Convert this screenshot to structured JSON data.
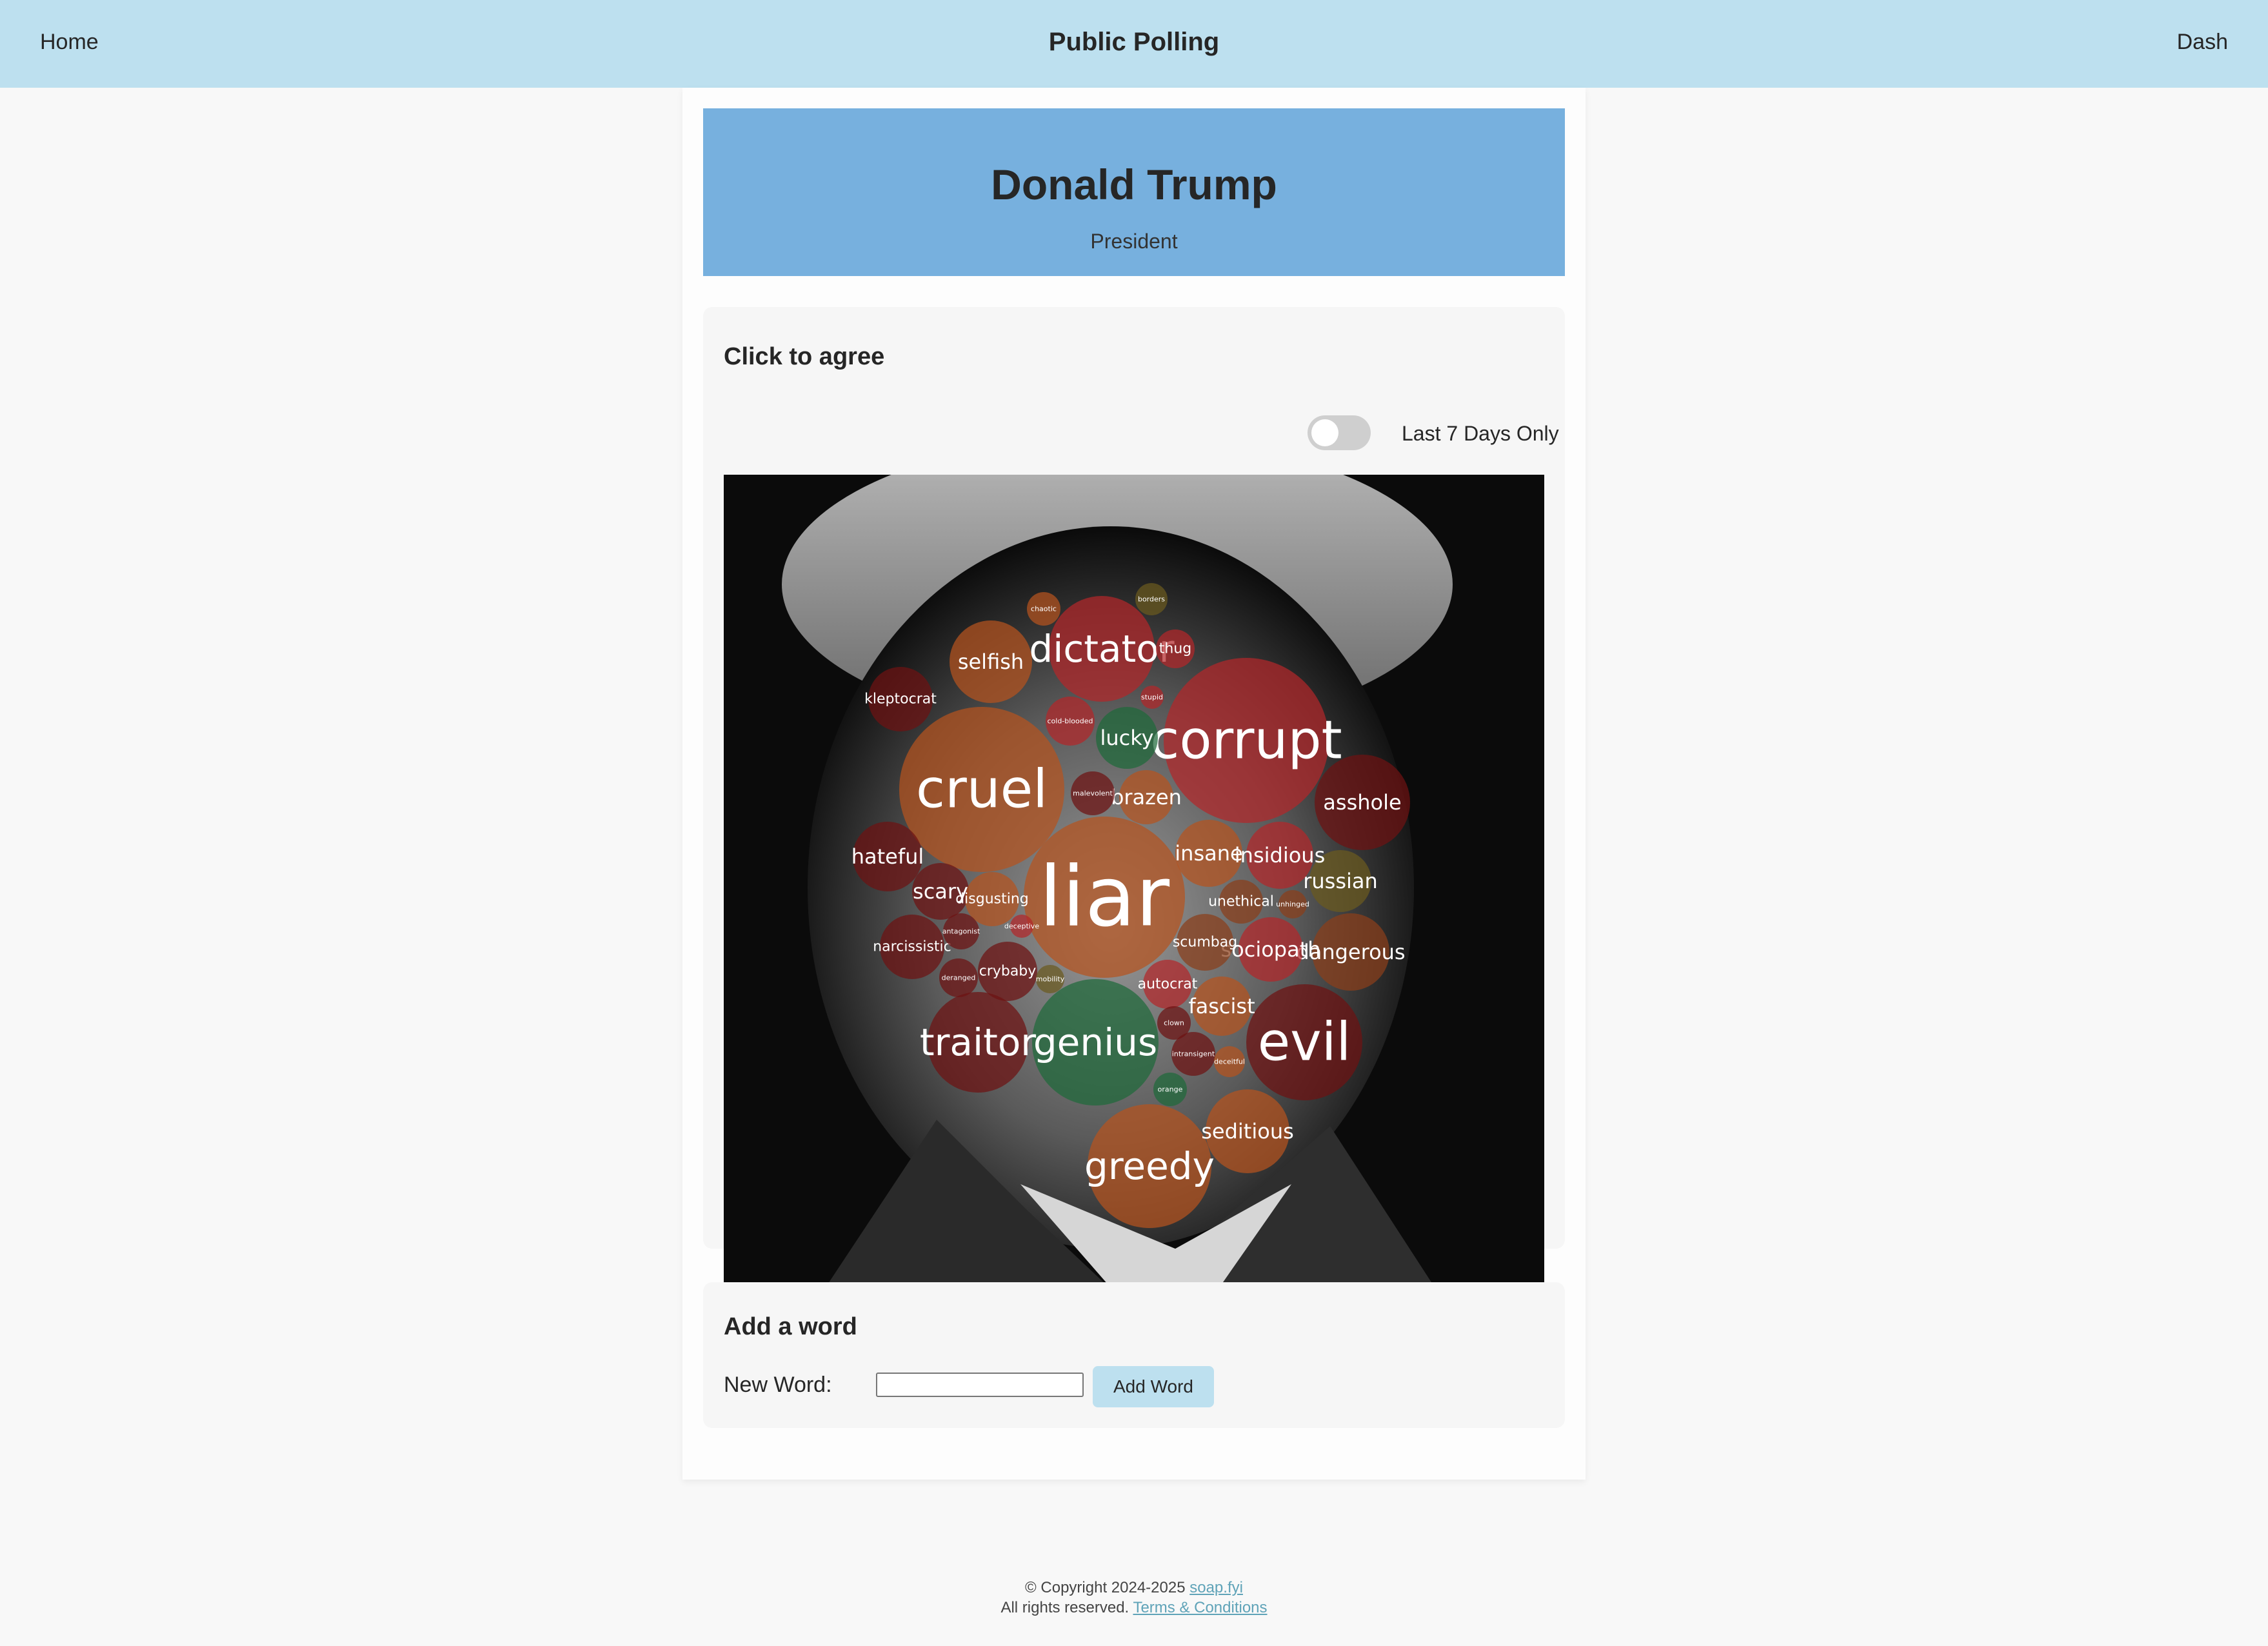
{
  "nav": {
    "home": "Home",
    "title": "Public Polling",
    "dash": "Dash"
  },
  "hero": {
    "name": "Donald Trump",
    "title": "President"
  },
  "agree_card": {
    "title": "Click to agree",
    "toggle_label": "Last 7 Days Only",
    "toggle_on": false
  },
  "bubbles": [
    {
      "word": "liar",
      "size": "xxl",
      "tone": "orange"
    },
    {
      "word": "corrupt",
      "size": "xl",
      "tone": "red"
    },
    {
      "word": "cruel",
      "size": "xl",
      "tone": "orange"
    },
    {
      "word": "evil",
      "size": "xl",
      "tone": "darkred"
    },
    {
      "word": "genius",
      "size": "l",
      "tone": "green"
    },
    {
      "word": "traitor",
      "size": "l",
      "tone": "darkred"
    },
    {
      "word": "greedy",
      "size": "l",
      "tone": "orange"
    },
    {
      "word": "dictator",
      "size": "l",
      "tone": "red"
    },
    {
      "word": "selfish",
      "size": "m",
      "tone": "orange"
    },
    {
      "word": "asshole",
      "size": "m",
      "tone": "darkred"
    },
    {
      "word": "lucky",
      "size": "m",
      "tone": "green"
    },
    {
      "word": "insane",
      "size": "m",
      "tone": "orange"
    },
    {
      "word": "hateful",
      "size": "m",
      "tone": "darkred"
    },
    {
      "word": "russian",
      "size": "m",
      "tone": "olive"
    },
    {
      "word": "dangerous",
      "size": "m",
      "tone": "darkorange"
    },
    {
      "word": "seditious",
      "size": "m",
      "tone": "orange"
    },
    {
      "word": "brazen",
      "size": "m",
      "tone": "orange"
    },
    {
      "word": "insidious",
      "size": "m",
      "tone": "red"
    },
    {
      "word": "scary",
      "size": "m",
      "tone": "darkred"
    },
    {
      "word": "fascist",
      "size": "m",
      "tone": "orange"
    },
    {
      "word": "sociopath",
      "size": "m",
      "tone": "red"
    },
    {
      "word": "scumbag",
      "size": "s",
      "tone": "darkorange"
    },
    {
      "word": "crybaby",
      "size": "s",
      "tone": "darkred"
    },
    {
      "word": "thug",
      "size": "s",
      "tone": "red"
    },
    {
      "word": "kleptocrat",
      "size": "s",
      "tone": "darkred"
    },
    {
      "word": "narcissistic",
      "size": "s",
      "tone": "darkred"
    },
    {
      "word": "autocrat",
      "size": "s",
      "tone": "red"
    },
    {
      "word": "disgusting",
      "size": "s",
      "tone": "orange"
    },
    {
      "word": "unethical",
      "size": "s",
      "tone": "darkorange"
    },
    {
      "word": "malevolent",
      "size": "xs",
      "tone": "darkred"
    },
    {
      "word": "cold-blooded",
      "size": "xs",
      "tone": "red"
    },
    {
      "word": "chaotic",
      "size": "xs",
      "tone": "orange"
    },
    {
      "word": "borders",
      "size": "xs",
      "tone": "olive"
    },
    {
      "word": "deranged",
      "size": "xs",
      "tone": "darkred"
    },
    {
      "word": "antagonist",
      "size": "xs",
      "tone": "darkred"
    },
    {
      "word": "intransigent",
      "size": "xs",
      "tone": "darkred"
    },
    {
      "word": "clown",
      "size": "xs",
      "tone": "darkred"
    },
    {
      "word": "orange",
      "size": "xs",
      "tone": "green"
    },
    {
      "word": "deceitful",
      "size": "xs",
      "tone": "orange"
    },
    {
      "word": "unhinged",
      "size": "xs",
      "tone": "darkorange"
    },
    {
      "word": "mobility",
      "size": "xs",
      "tone": "olive"
    },
    {
      "word": "deceptive",
      "size": "xs",
      "tone": "red"
    },
    {
      "word": "stupid",
      "size": "xs",
      "tone": "red"
    }
  ],
  "add_card": {
    "title": "Add a word",
    "label": "New Word:",
    "input_value": "",
    "button": "Add Word"
  },
  "footer": {
    "copyright": "© Copyright 2024-2025",
    "site": "soap.fyi",
    "rights": "All rights reserved.",
    "terms": "Terms & Conditions"
  },
  "colors": {
    "nav_bg": "#bde0ef",
    "hero_bg": "#77b0de",
    "page_bg": "#f8f8f8",
    "bubble_red": "#b3272a",
    "bubble_darkred": "#6e1212",
    "bubble_orange": "#b5531f",
    "bubble_darkorange": "#8a3f1a",
    "bubble_green": "#1f6a3a",
    "bubble_olive": "#6b5a1e"
  }
}
